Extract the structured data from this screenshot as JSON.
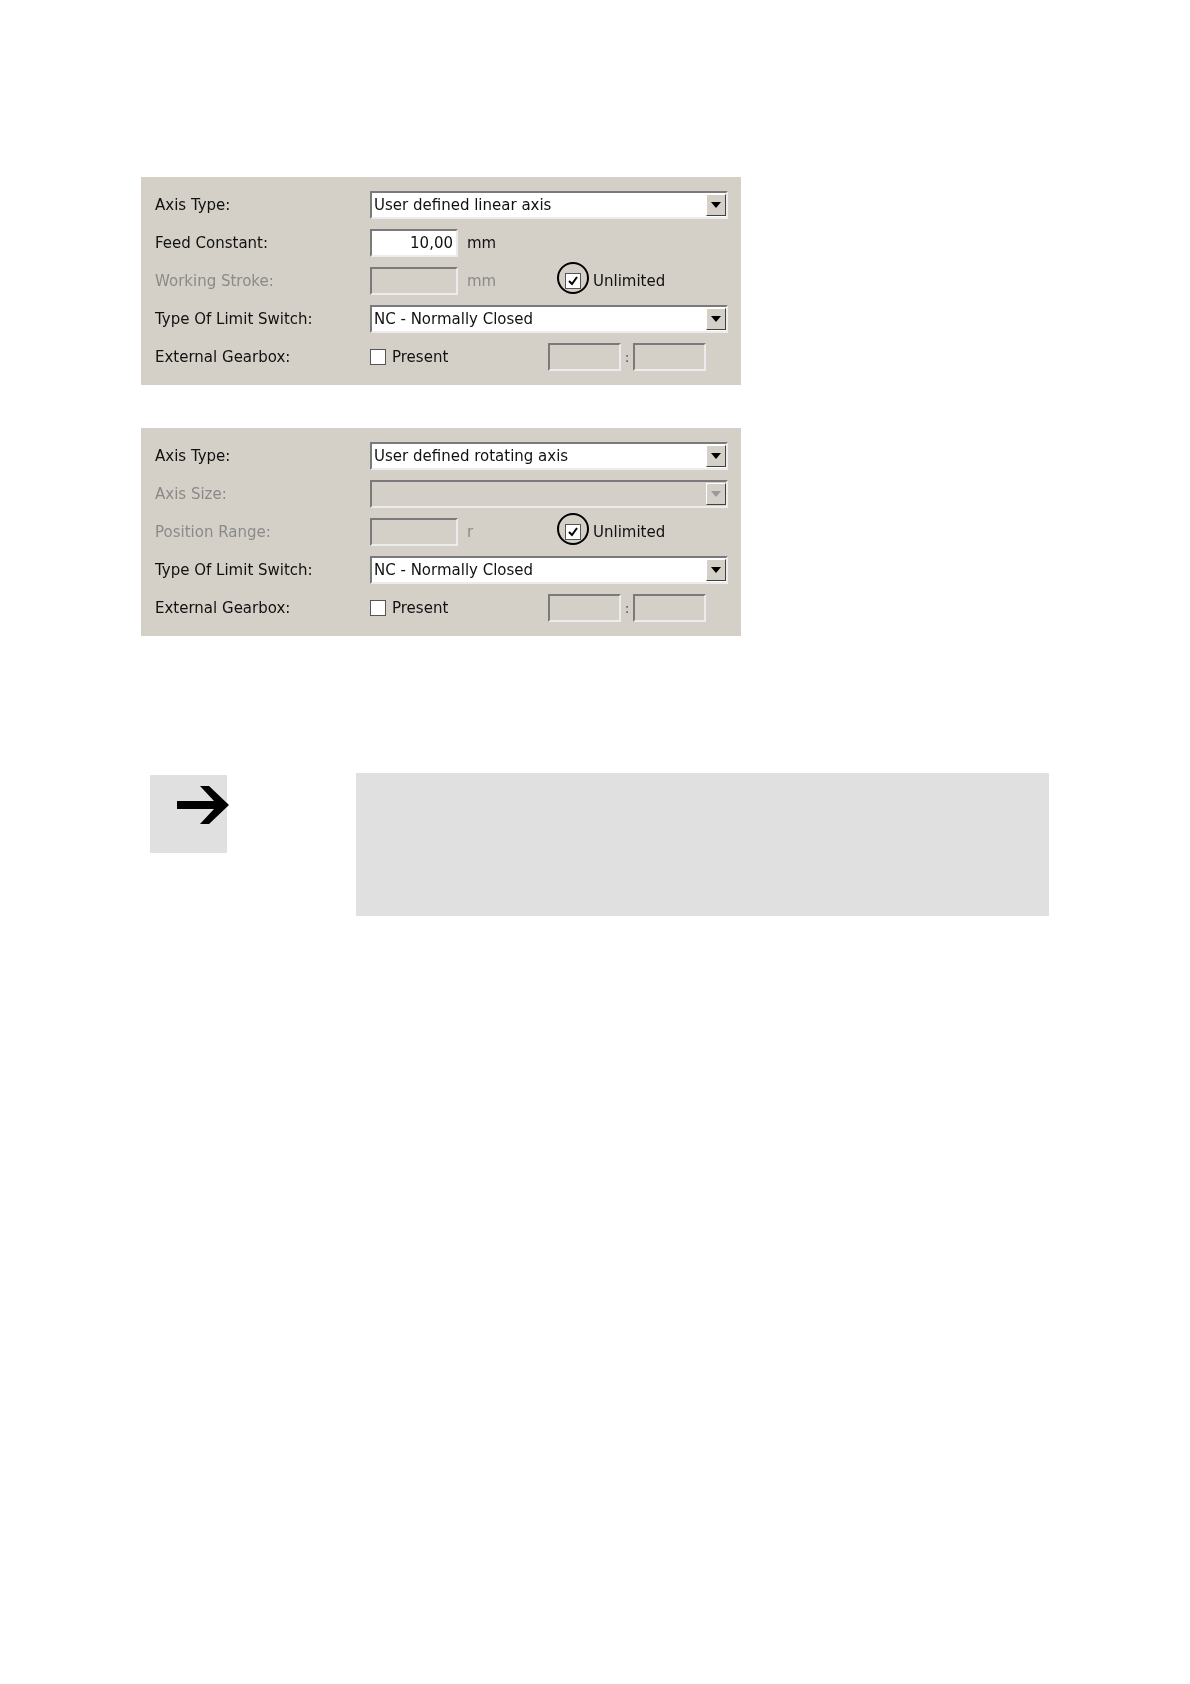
{
  "panels": [
    {
      "rows": [
        {
          "kind": "dropdown",
          "label": "Axis Type:",
          "value": "User defined linear axis",
          "disabled": false
        },
        {
          "kind": "number",
          "label": "Feed Constant:",
          "value": "10,00",
          "unit": "mm",
          "disabled": false
        },
        {
          "kind": "range",
          "label": "Working Stroke:",
          "unit": "mm",
          "disabled": true,
          "option": {
            "label": "Unlimited",
            "checked": true,
            "highlighted": true
          }
        },
        {
          "kind": "dropdown",
          "label": "Type Of Limit Switch:",
          "value": "NC - Normally Closed",
          "disabled": false
        },
        {
          "kind": "gearbox",
          "label": "External Gearbox:",
          "option": {
            "label": "Present",
            "checked": false
          },
          "separator": ":"
        }
      ]
    },
    {
      "rows": [
        {
          "kind": "dropdown",
          "label": "Axis Type:",
          "value": "User defined rotating axis",
          "disabled": false
        },
        {
          "kind": "dropdown",
          "label": "Axis Size:",
          "disabled": true
        },
        {
          "kind": "range",
          "label": "Position Range:",
          "unit": "r",
          "disabled": true,
          "option": {
            "label": "Unlimited",
            "checked": true,
            "highlighted": true
          }
        },
        {
          "kind": "dropdown",
          "label": "Type Of Limit Switch:",
          "value": "NC - Normally Closed",
          "disabled": false
        },
        {
          "kind": "gearbox",
          "label": "External Gearbox:",
          "option": {
            "label": "Present",
            "checked": false
          },
          "separator": ":"
        }
      ]
    }
  ]
}
